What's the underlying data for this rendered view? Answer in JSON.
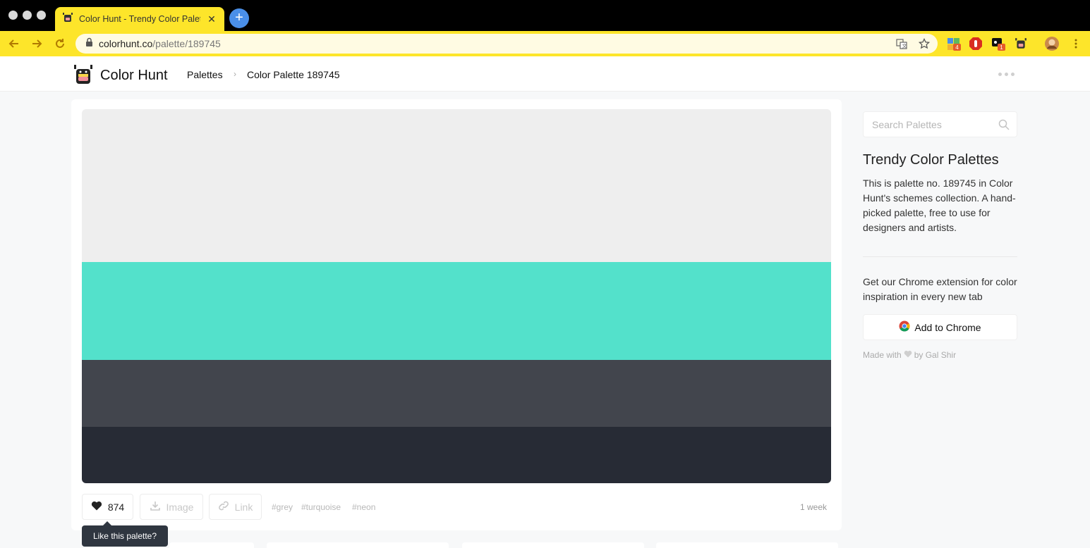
{
  "browser": {
    "tab_title": "Color Hunt - Trendy Color Palettes",
    "url_host": "colorhunt.co",
    "url_path": "/palette/189745",
    "extension_badges": [
      "4",
      "1"
    ]
  },
  "header": {
    "logo_text": "Color Hunt",
    "breadcrumb_palettes": "Palettes",
    "breadcrumb_current": "Color Palette 189745"
  },
  "palette": {
    "colors": [
      "#eeeeee",
      "#53e1cb",
      "#42454d",
      "#272b35"
    ]
  },
  "actions": {
    "likes": "874",
    "image_label": "Image",
    "link_label": "Link",
    "tags": [
      "#grey",
      "#turquoise",
      "#neon"
    ],
    "time": "1 week",
    "tooltip": "Like this palette?"
  },
  "sidebar": {
    "search_placeholder": "Search Palettes",
    "title": "Trendy Color Palettes",
    "description": "This is palette no. 189745 in Color Hunt's schemes collection. A hand-picked palette, free to use for designers and artists.",
    "extension_text": "Get our Chrome extension for color inspiration in every new tab",
    "add_to_chrome": "Add to Chrome",
    "made_with_prefix": "Made with",
    "made_with_suffix": "by Gal Shir"
  }
}
